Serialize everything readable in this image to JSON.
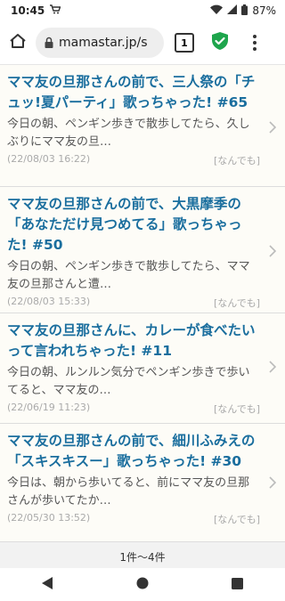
{
  "status_bar": {
    "time": "10:45",
    "battery": "87%",
    "icons": [
      "cart-icon",
      "wifi-icon",
      "signal-icon",
      "battery-icon"
    ]
  },
  "browser": {
    "url": "mamastar.jp/s",
    "tab_count": "1",
    "icons": [
      "home-icon",
      "lock-icon",
      "shield-check-icon",
      "more-vert-icon"
    ]
  },
  "articles": [
    {
      "title": "ママ友の旦那さんの前で、三人祭の「チュッ!夏パーティ」歌っちゃった! #65",
      "excerpt": "今日の朝、ペンギン歩きで散歩してたら、久しぶりにママ友の旦…",
      "date": "(22/08/03 16:22)",
      "category": "[なんでも]"
    },
    {
      "title": "ママ友の旦那さんの前で、大黒摩季の「あなただけ見つめてる」歌っちゃった! #50",
      "excerpt": "今日の朝、ペンギン歩きで散歩してたら、ママ友の旦那さんと遭…",
      "date": "(22/08/03 15:33)",
      "category": "[なんでも]"
    },
    {
      "title": "ママ友の旦那さんに、カレーが食べたいって言われちゃった! #11",
      "excerpt": "今日の朝、ルンルン気分でペンギン歩きで歩いてると、ママ友の…",
      "date": "(22/06/19 11:23)",
      "category": "[なんでも]"
    },
    {
      "title": "ママ友の旦那さんの前で、細川ふみえの「スキスキスー」歌っちゃった! #30",
      "excerpt": "今日は、朝から歩いてると、前にママ友の旦那さんが歩いてたか…",
      "date": "(22/05/30 13:52)",
      "category": "[なんでも]"
    }
  ],
  "pager": "1件〜4件",
  "colors": {
    "title": "#1a6e9e",
    "shield": "#1ea54c",
    "card_bg": "#fdfcf7"
  }
}
